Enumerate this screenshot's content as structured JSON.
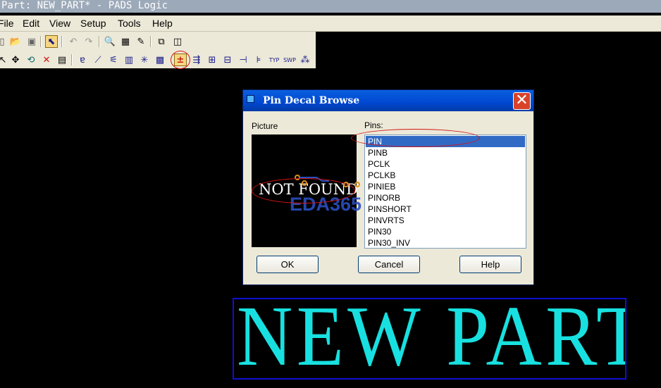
{
  "window": {
    "title": "Part: NEW_PART* - PADS Logic"
  },
  "menubar": {
    "items": [
      "File",
      "Edit",
      "View",
      "Setup",
      "Tools",
      "Help"
    ]
  },
  "toolbar1": {
    "icons": [
      "new-icon",
      "open-icon",
      "save-icon",
      "select-icon",
      "undo-icon",
      "redo-icon",
      "zoom-icon",
      "library-icon",
      "eraser-icon",
      "import-icon",
      "window-icon"
    ]
  },
  "toolbar2": {
    "icons": [
      "select-arrow-icon",
      "move-icon",
      "rotate-icon",
      "delete-icon",
      "properties-icon",
      "text-icon",
      "line-icon",
      "terminal-icon",
      "pin-type-icon",
      "sparkle-icon",
      "color-icon",
      "add-pin-icon",
      "pin-decal-icon",
      "pin-array-icon",
      "pin-group-icon",
      "pin-pair-icon",
      "pin-number-icon",
      "type-icon",
      "swap-icon",
      "pin-matrix-icon"
    ],
    "selected_icon": "add-pin-icon"
  },
  "dialog": {
    "title": "Pin Decal Browse",
    "picture_label": "Picture",
    "picture_text": "NOT FOUND",
    "watermark": "EDA365",
    "pins_label": "Pins:",
    "pins": [
      "PIN",
      "PINB",
      "PCLK",
      "PCLKB",
      "PINIEB",
      "PINORB",
      "PINSHORT",
      "PINVRTS",
      "PIN30",
      "PIN30_INV"
    ],
    "selected_pin": "PIN",
    "ok_label": "OK",
    "cancel_label": "Cancel",
    "help_label": "Help"
  },
  "canvas": {
    "part_name": "NEW PART"
  },
  "colors": {
    "titlebar": "#9ca9b8",
    "dialog_title": "#0054e3",
    "selection": "#316ac5",
    "part_text": "#18e0e0",
    "part_outline": "#1010d0",
    "annotation": "#d41414"
  }
}
